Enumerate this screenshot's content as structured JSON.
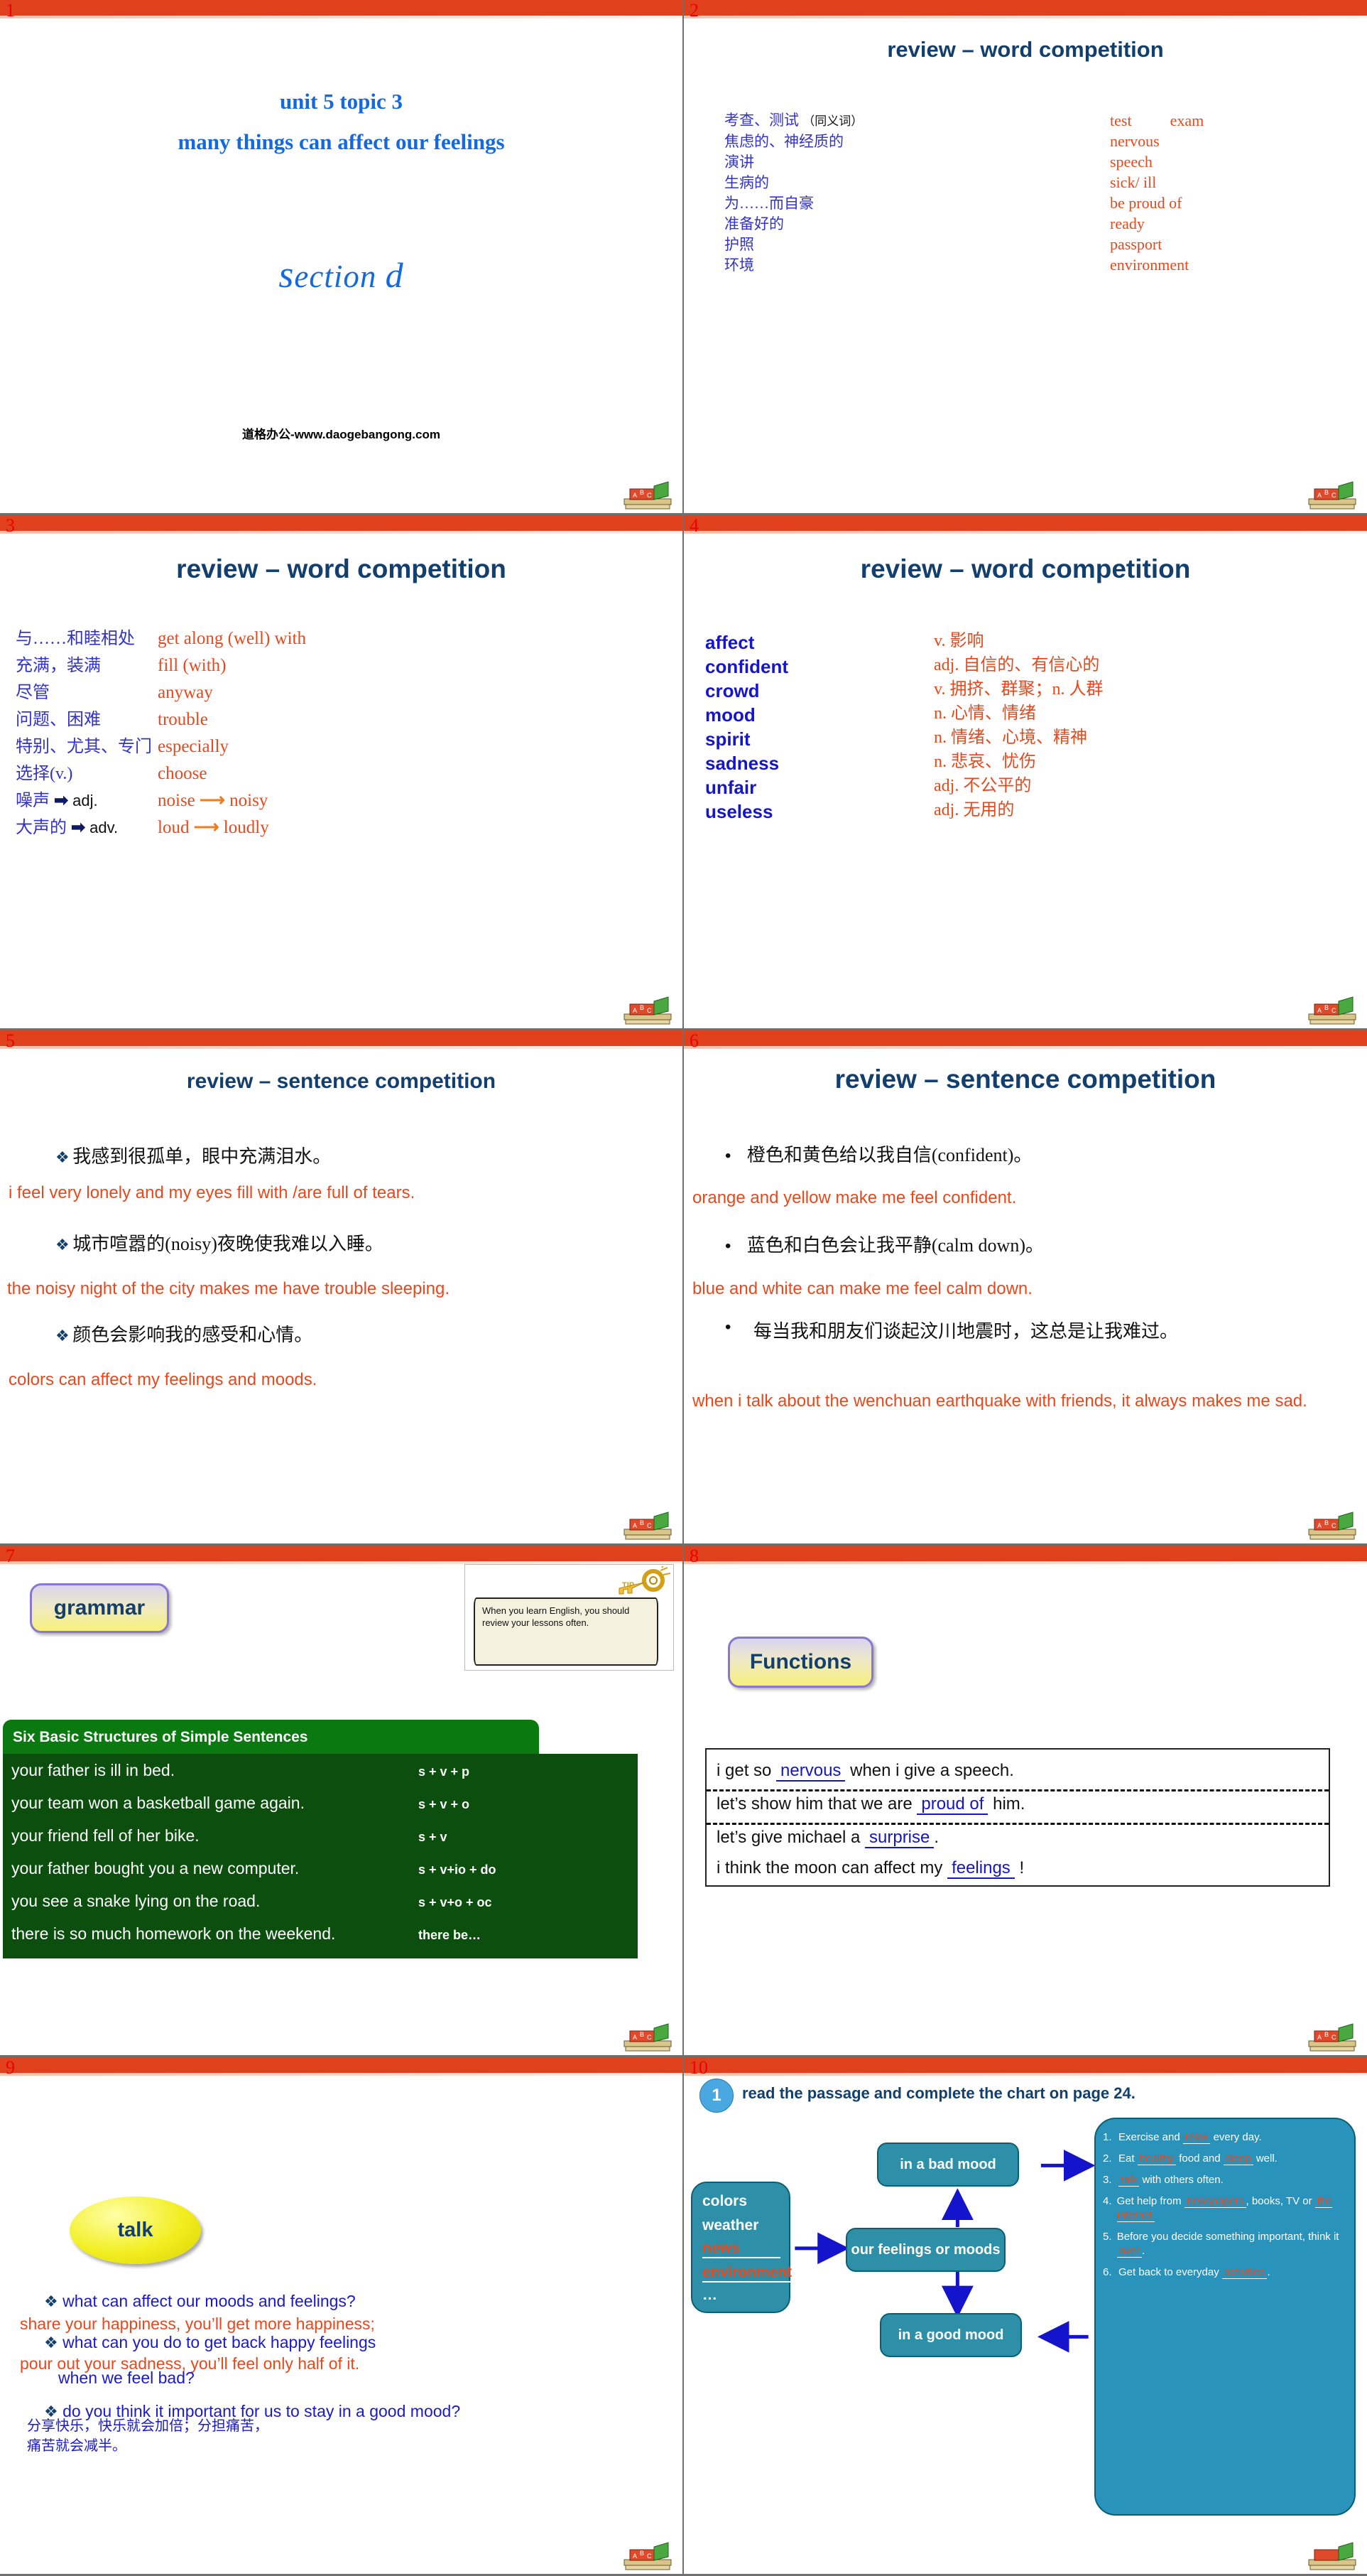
{
  "slides": [
    {
      "number": "1",
      "title_line1": "unit 5 topic 3",
      "title_line2": "many things can affect our feelings",
      "section": "ection",
      "section_first": "s",
      "section_letter": "d",
      "watermark": "道格办公-www.daogebangong.com"
    },
    {
      "number": "2",
      "title": "review – word competition",
      "synonym_note": "（同义词）",
      "pairs": [
        {
          "cn": "考查、测试",
          "en": "test",
          "en2": "exam"
        },
        {
          "cn": "焦虑的、神经质的",
          "en": "nervous"
        },
        {
          "cn": "演讲",
          "en": "speech"
        },
        {
          "cn": "生病的",
          "en": "sick/ ill"
        },
        {
          "cn": "为……而自豪",
          "en": "be proud of"
        },
        {
          "cn": "准备好的",
          "en": "ready"
        },
        {
          "cn": "护照",
          "en": "passport"
        },
        {
          "cn": "环境",
          "en": "environment"
        }
      ]
    },
    {
      "number": "3",
      "title": "review – word competition",
      "pairs": [
        {
          "cn": "与……和睦相处",
          "en": "get along (well) with"
        },
        {
          "cn": "充满，装满",
          "en": "fill (with)"
        },
        {
          "cn": "尽管",
          "en": "anyway"
        },
        {
          "cn": "问题、困难",
          "en": "trouble"
        },
        {
          "cn": "特别、尤其、专门",
          "en": "especially"
        },
        {
          "cn": "选择(v.)",
          "en": "choose"
        },
        {
          "cn": "噪声",
          "pos": "adj.",
          "en": "noise",
          "en_derived": "noisy"
        },
        {
          "cn": "大声的",
          "pos": "adv.",
          "en": "loud",
          "en_derived": "loudly"
        }
      ]
    },
    {
      "number": "4",
      "title": "review – word competition",
      "pairs": [
        {
          "word": "affect",
          "meaning": "v. 影响"
        },
        {
          "word": "confident",
          "meaning": "adj. 自信的、有信心的"
        },
        {
          "word": "crowd",
          "meaning": "v. 拥挤、群聚；n. 人群"
        },
        {
          "word": "mood",
          "meaning": "n. 心情、情绪"
        },
        {
          "word": "spirit",
          "meaning": "n. 情绪、心境、精神"
        },
        {
          "word": "sadness",
          "meaning": "n. 悲哀、忧伤"
        },
        {
          "word": "unfair",
          "meaning": "adj. 不公平的"
        },
        {
          "word": "useless",
          "meaning": "adj. 无用的"
        }
      ]
    },
    {
      "number": "5",
      "title": "review – sentence competition",
      "items": [
        {
          "cn": "我感到很孤单，眼中充满泪水。",
          "en": "i feel very lonely and my eyes fill with /are full of  tears."
        },
        {
          "cn": "城市喧嚣的(noisy)夜晚使我难以入睡。",
          "en": "the noisy night of the city makes me have trouble sleeping."
        },
        {
          "cn": "颜色会影响我的感受和心情。",
          "en": "colors can affect my feelings and moods."
        }
      ]
    },
    {
      "number": "6",
      "title": "review – sentence competition",
      "items": [
        {
          "cn": "橙色和黄色给以我自信(confident)。",
          "en": "orange and yellow make me feel confident."
        },
        {
          "cn": "蓝色和白色会让我平静(calm down)。",
          "en": "blue and white can make me feel calm down."
        },
        {
          "cn": "每当我和朋友们谈起汶川地震时，这总是让我难过。",
          "en": "when i talk about the wenchuan earthquake with friends, it always makes me sad."
        }
      ]
    },
    {
      "number": "7",
      "pill_label": "grammar",
      "tip_text": "When you learn English, you should review your lessons often.",
      "tip_key_label": "TIP",
      "table_header": "Six Basic Structures of Simple Sentences",
      "rows": [
        {
          "sentence": "your father is ill in bed.",
          "code": "s + v + p"
        },
        {
          "sentence": "your team won a basketball game again.",
          "code": "s + v + o"
        },
        {
          "sentence": "your friend fell of her bike.",
          "code": "s + v"
        },
        {
          "sentence": "your father bought you a new computer.",
          "code": "s + v+io + do"
        },
        {
          "sentence": "you see a snake lying on the road.",
          "code": "s + v+o + oc"
        },
        {
          "sentence": "there is so much homework on the weekend.",
          "code": "there be…"
        }
      ]
    },
    {
      "number": "8",
      "pill_label": "Functions",
      "lines": [
        {
          "before": "i get so ",
          "blank": "nervous",
          "after": " when i give a speech."
        },
        {
          "before": "let’s show him that we are ",
          "blank": "proud of",
          "after": " him."
        },
        {
          "before": "let’s give michael a ",
          "blank": "surprise",
          "after": "."
        },
        {
          "before": "i think the moon can affect my ",
          "blank": "feelings",
          "after": " !"
        }
      ]
    },
    {
      "number": "9",
      "pill_label": "talk",
      "q1": "what can affect our moods and feelings?",
      "a1": "share your happiness, you’ll get more happiness;",
      "q2": "what can you do to get back happy feelings",
      "a2": "pour out your sadness, you’ll feel only half of it.",
      "q2b": "when we feel bad?",
      "cn_note": "分享快乐，快乐就会加倍；分担痛苦，痛苦就会减半。",
      "q3": "do you think it important for us to stay in a good mood?"
    },
    {
      "number": "10",
      "step_num": "1",
      "heading": "read the passage and complete the chart on page 24."
    }
  ],
  "chart_data": {
    "type": "diagram",
    "title": "read the passage and complete the chart on page 24.",
    "source_box": {
      "items": [
        "colors",
        "weather"
      ],
      "fill_items": [
        "news",
        "environment"
      ],
      "ellipsis": "…"
    },
    "center_node": "our feelings or moods",
    "top_node": "in a bad mood",
    "bottom_node": "in a good mood",
    "advice": [
      {
        "num": "1.",
        "parts": [
          "Exercise and ",
          "relax",
          " every day."
        ]
      },
      {
        "num": "2.",
        "parts": [
          " Eat ",
          "healthy",
          " food and ",
          "sleep",
          " well."
        ]
      },
      {
        "num": "3.",
        "parts": [
          "",
          "talk",
          " with others often."
        ]
      },
      {
        "num": "4.",
        "parts": [
          "Get help from ",
          "newspapers",
          ", books, TV  or ",
          "the internet",
          ""
        ]
      },
      {
        "num": "5.",
        "parts": [
          "Before you decide something important, think it ",
          "over",
          "."
        ]
      },
      {
        "num": "6.",
        "parts": [
          "Get back to everyday ",
          "activities",
          "."
        ]
      }
    ],
    "colors": {
      "node": "#2e8fa8",
      "panel": "#2a93bb",
      "arrow": "#1414cc",
      "fill_text": "#e8481c"
    }
  },
  "theme": {
    "top_bar": "#e0401c",
    "title_blue": "#123f6e",
    "cn_blue": "#3333cc",
    "en_orange": "#e8481c",
    "green_header": "#0a7a10",
    "green_body": "#0b4e0e"
  }
}
